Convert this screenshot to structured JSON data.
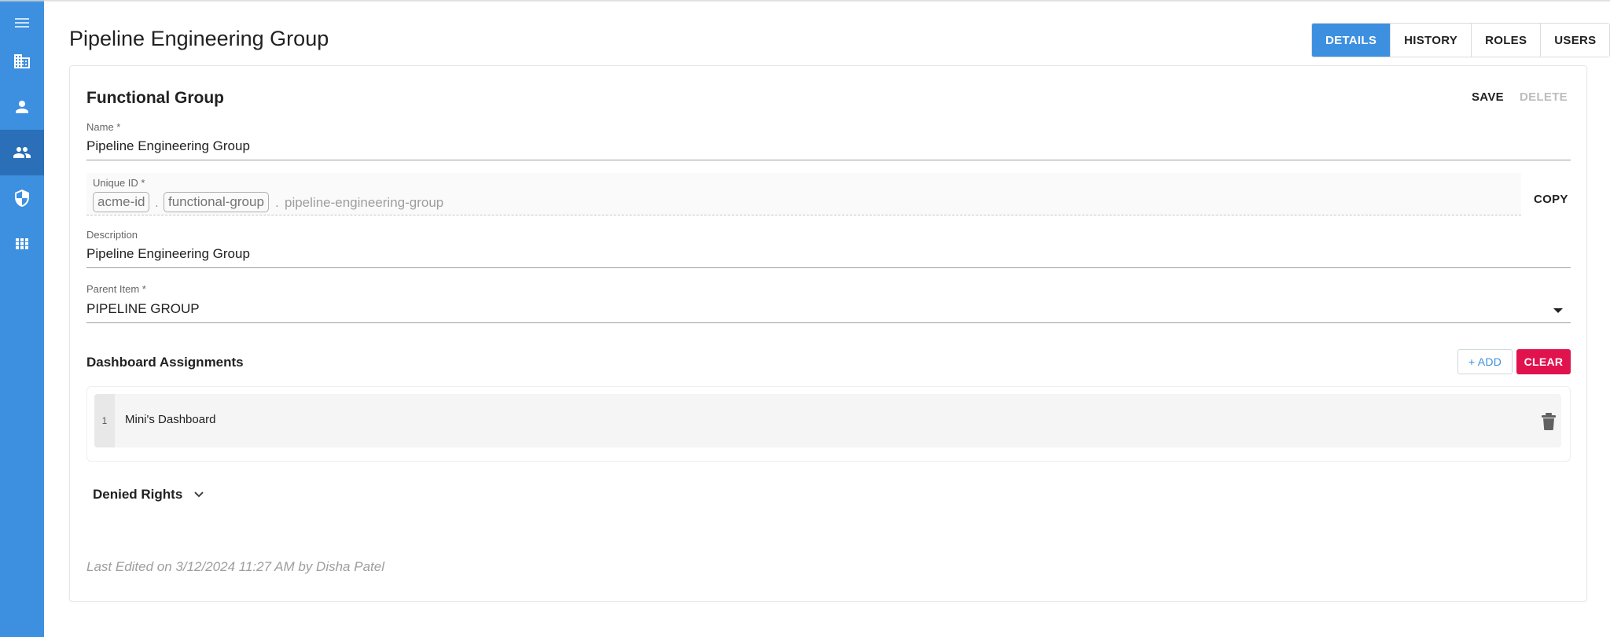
{
  "header": {
    "title": "Pipeline Engineering Group",
    "tabs": [
      "DETAILS",
      "HISTORY",
      "ROLES",
      "USERS"
    ],
    "active_tab": "DETAILS"
  },
  "sidebar": {
    "items": [
      {
        "icon": "menu-icon"
      },
      {
        "icon": "building-icon"
      },
      {
        "icon": "person-icon"
      },
      {
        "icon": "people-icon",
        "active": true
      },
      {
        "icon": "shield-icon"
      },
      {
        "icon": "apps-grid-icon"
      }
    ]
  },
  "card": {
    "title": "Functional Group",
    "save_label": "SAVE",
    "delete_label": "DELETE"
  },
  "form": {
    "name": {
      "label": "Name *",
      "value": "Pipeline Engineering Group"
    },
    "unique_id": {
      "label": "Unique ID *",
      "chips": [
        "acme-id",
        "functional-group"
      ],
      "separator": ".",
      "value": "pipeline-engineering-group",
      "copy_label": "COPY"
    },
    "description": {
      "label": "Description",
      "value": "Pipeline Engineering Group"
    },
    "parent_item": {
      "label": "Parent Item *",
      "value": "PIPELINE GROUP"
    }
  },
  "dashboard_assignments": {
    "title": "Dashboard Assignments",
    "add_label": "+ ADD",
    "clear_label": "CLEAR",
    "rows": [
      {
        "index": "1",
        "label": "Mini's Dashboard"
      }
    ]
  },
  "denied_rights": {
    "title": "Denied Rights"
  },
  "footer": {
    "last_edited": "Last Edited on 3/12/2024 11:27 AM by Disha Patel"
  },
  "colors": {
    "primary": "#3d8fe0",
    "sidebar_active": "#2a6fb8",
    "danger": "#e0134f"
  }
}
